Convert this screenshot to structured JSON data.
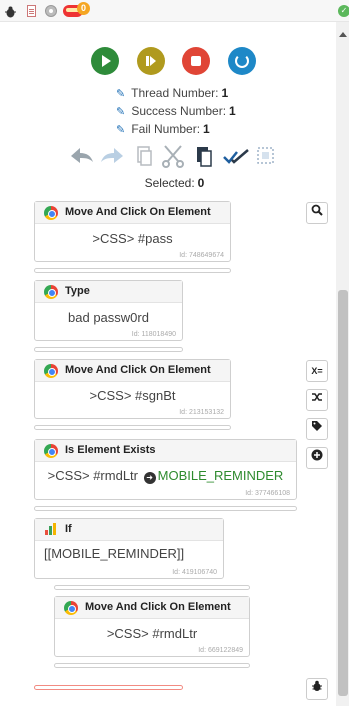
{
  "toolbar": {
    "badge": "0"
  },
  "stats": {
    "thread_label": "Thread Number:",
    "thread_value": "1",
    "success_label": "Success Number:",
    "success_value": "1",
    "fail_label": "Fail Number:",
    "fail_value": "1"
  },
  "selection": {
    "label": "Selected:",
    "count": "0"
  },
  "side_tools": {
    "var_label": "X="
  },
  "blocks": [
    {
      "title": "Move And Click On Element",
      "body": ">CSS> #pass",
      "id": "Id: 748649674",
      "icon": "chrome-icon"
    },
    {
      "title": "Type",
      "body": "bad passw0rd",
      "id": "Id: 118018490",
      "icon": "chrome-icon"
    },
    {
      "title": "Move And Click On Element",
      "body": ">CSS> #sgnBt",
      "id": "Id: 213153132",
      "icon": "chrome-icon"
    },
    {
      "title": "Is Element Exists",
      "body": ">CSS> #rmdLtr",
      "target": "MOBILE_REMINDER",
      "id": "Id: 377466108",
      "icon": "chrome-icon"
    },
    {
      "title": "If",
      "body": "[[MOBILE_REMINDER]]",
      "id": "Id: 419106740",
      "icon": "chart-icon"
    },
    {
      "title": "Move And Click On Element",
      "body": ">CSS> #rmdLtr",
      "id": "Id: 669122849",
      "icon": "chrome-icon"
    }
  ],
  "colors": {
    "play": "#2e8b3a",
    "pause": "#b09a1e",
    "stop": "#e04536",
    "reload": "#1e88c7",
    "target_text": "#2e8b2e",
    "empty_drop_zone": "#f28b82"
  }
}
